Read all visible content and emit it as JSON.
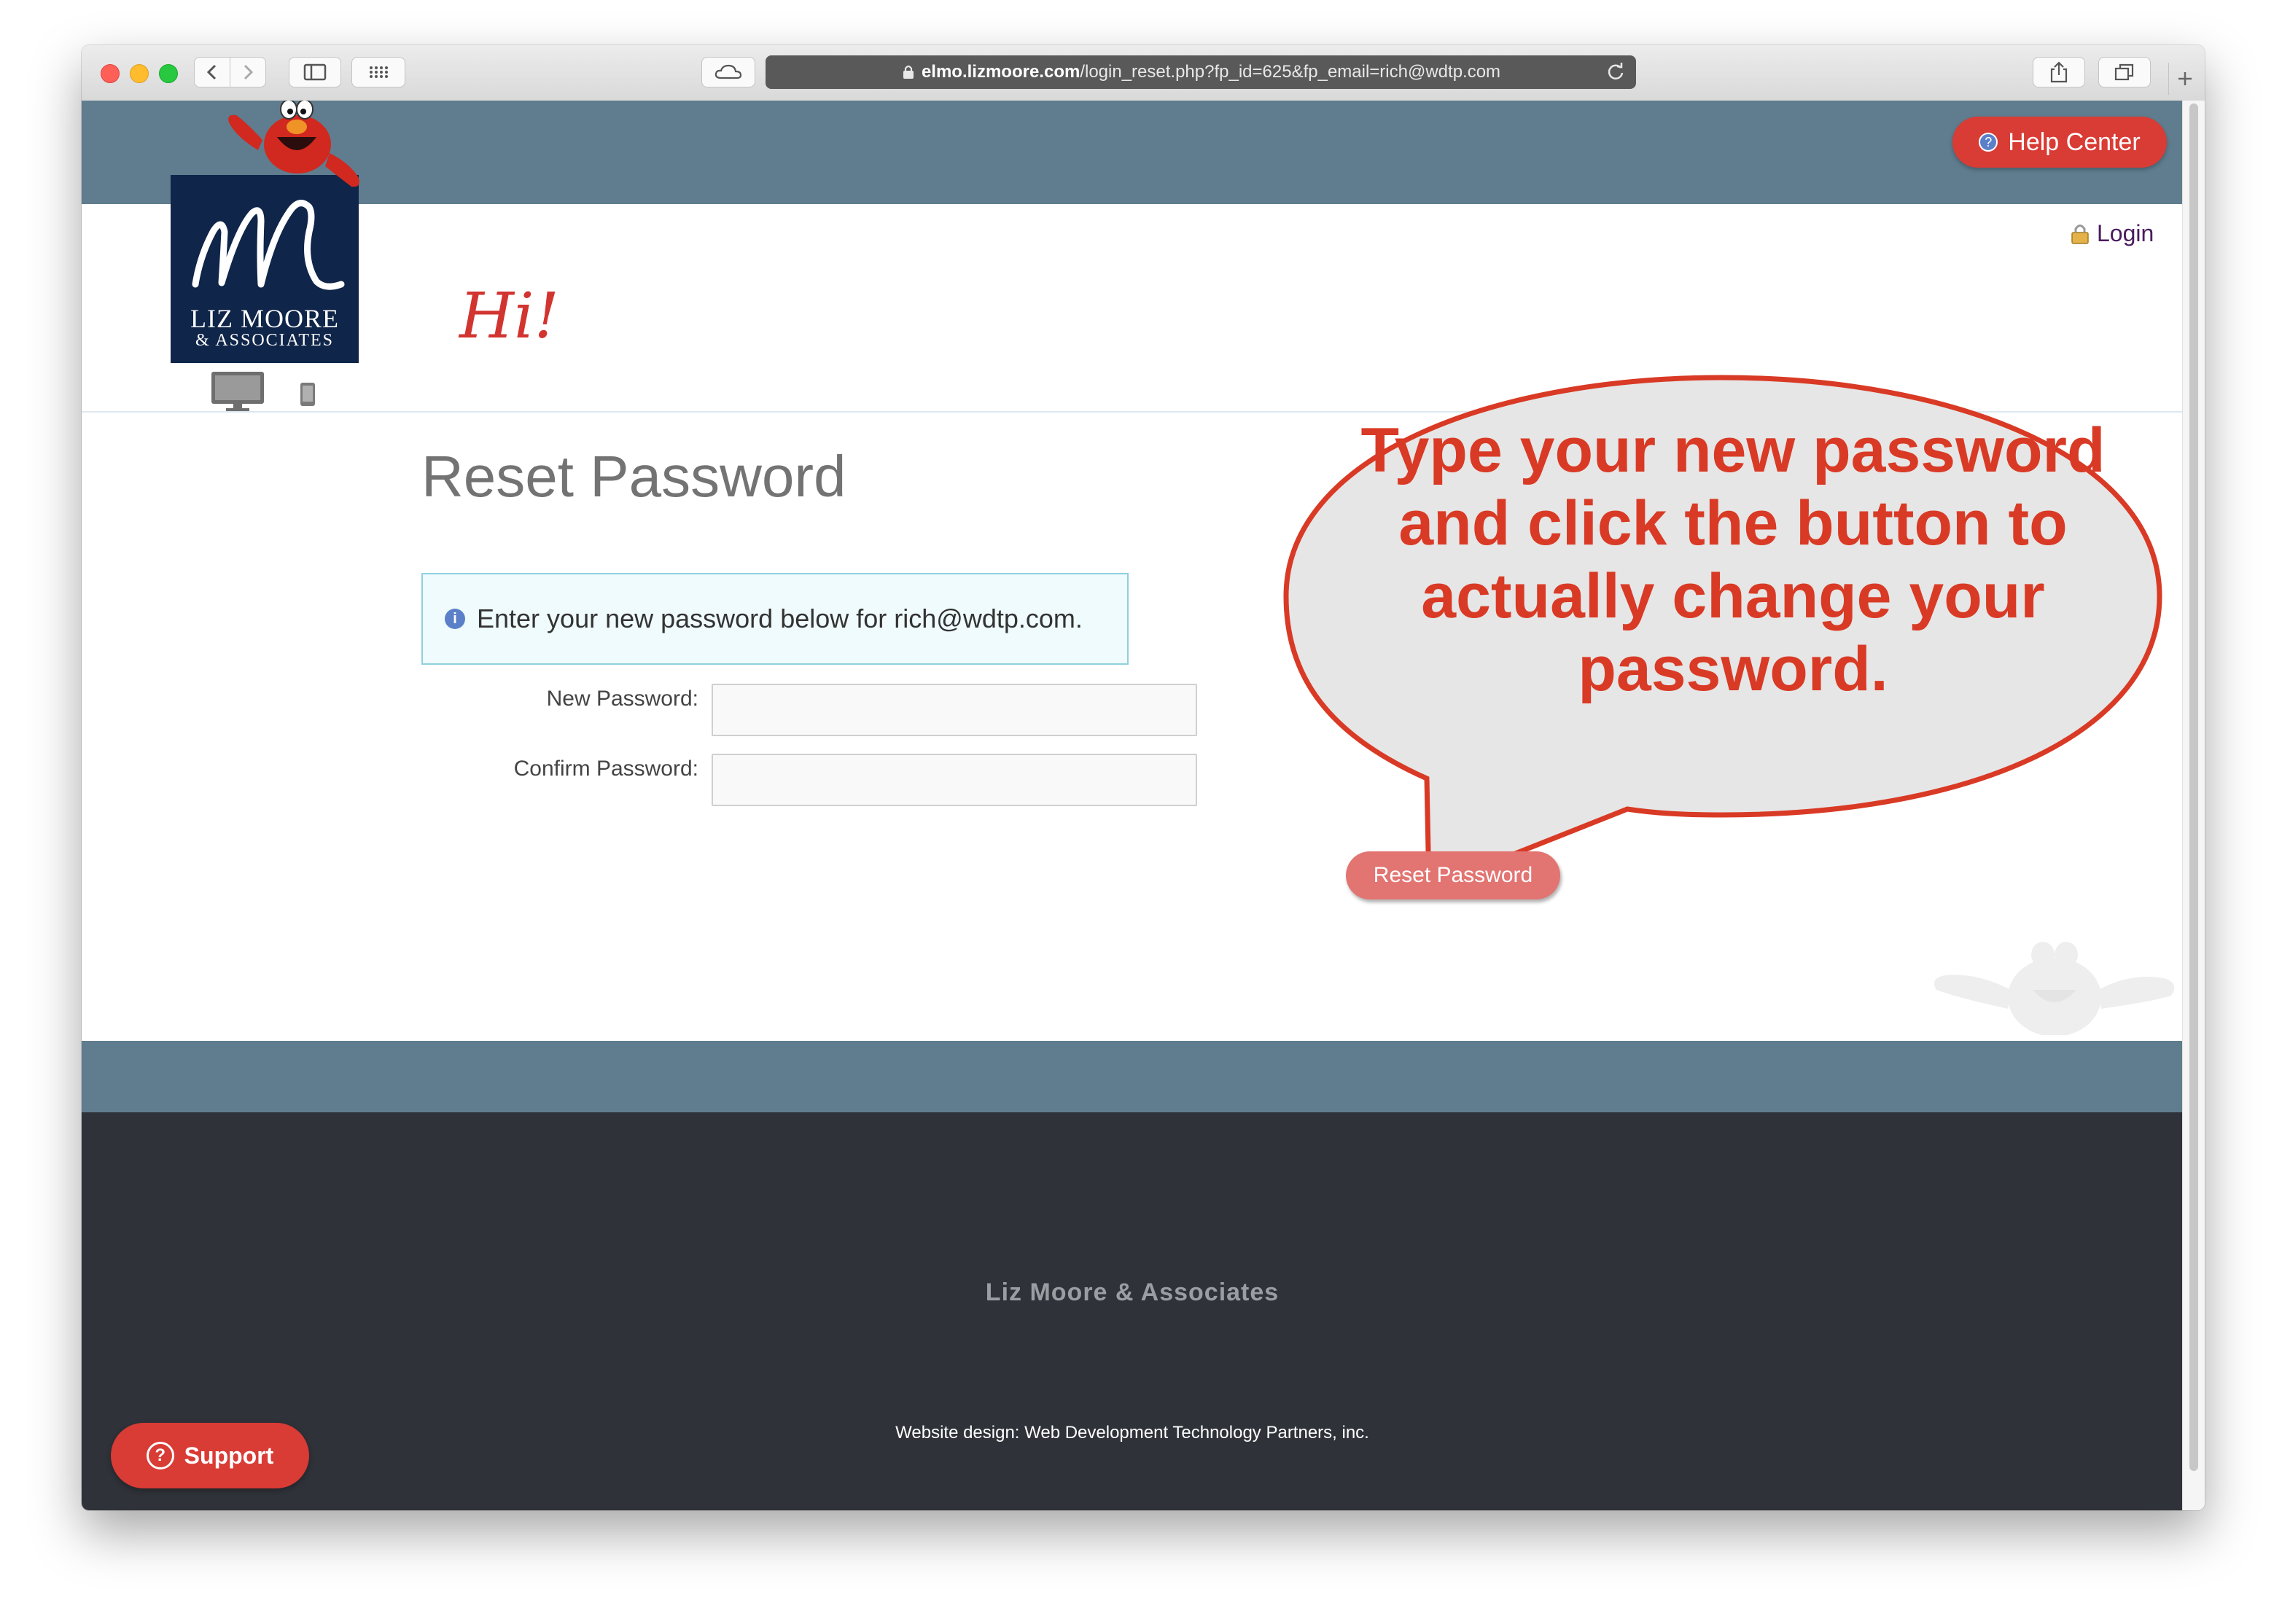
{
  "browser": {
    "url_host": "elmo.lizmoore.com",
    "url_path": "/login_reset.php?fp_id=625&fp_email=rich@wdtp.com"
  },
  "header": {
    "help_label": "Help Center",
    "login_label": "Login",
    "greeting": "Hi!",
    "logo": {
      "name": "LIZ MOORE",
      "sub": "& ASSOCIATES"
    }
  },
  "main": {
    "title": "Reset Password",
    "info_message": "Enter your new password below for rich@wdtp.com.",
    "new_password_label": "New Password:",
    "confirm_password_label": "Confirm Password:",
    "new_password_value": "",
    "confirm_password_value": "",
    "submit_label": "Reset Password"
  },
  "callout": {
    "text": "Type your new password and click the button to actually change your password."
  },
  "footer": {
    "company": "Liz Moore & Associates",
    "credit": "Website design: Web Development Technology Partners, inc."
  },
  "support": {
    "label": "Support"
  },
  "colors": {
    "header_band": "#5f7d8f",
    "accent_red": "#d93b35",
    "logo_navy": "#0f2549",
    "footer_dark": "#2f3239",
    "callout_text": "#d93a25"
  }
}
